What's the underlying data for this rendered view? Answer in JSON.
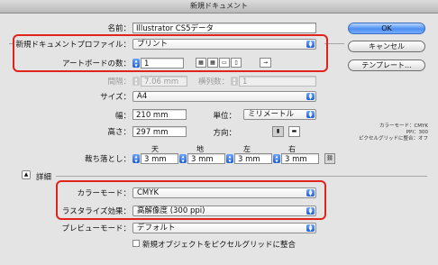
{
  "window": {
    "title": "新規ドキュメント"
  },
  "fields": {
    "name_label": "名前：",
    "name_value": "Illustrator CS5データ",
    "profile_label": "新規ドキュメントプロファイル：",
    "profile_value": "プリント",
    "artboards_label": "アートボードの数：",
    "artboards_value": "1",
    "spacing_label": "間隔：",
    "spacing_value": "7.06 mm",
    "columns_label": "横列数：",
    "columns_value": "1",
    "size_label": "サイズ：",
    "size_value": "A4",
    "width_label": "幅：",
    "width_value": "210 mm",
    "units_label": "単位：",
    "units_value": "ミリメートル",
    "height_label": "高さ：",
    "height_value": "297 mm",
    "orientation_label": "方向：",
    "bleed_label": "裁ち落とし：",
    "bleed_top_label": "天",
    "bleed_bottom_label": "地",
    "bleed_left_label": "左",
    "bleed_right_label": "右",
    "bleed_top": "3 mm",
    "bleed_bottom": "3 mm",
    "bleed_left": "3 mm",
    "bleed_right": "3 mm",
    "advanced_label": "詳細",
    "color_mode_label": "カラーモード：",
    "color_mode_value": "CMYK",
    "raster_label": "ラスタライズ効果：",
    "raster_value": "高解像度 (300 ppi)",
    "preview_label": "プレビューモード：",
    "preview_value": "デフォルト",
    "align_pixel_label": "新規オブジェクトをピクセルグリッドに整合"
  },
  "buttons": {
    "ok": "OK",
    "cancel": "キャンセル",
    "templates": "テンプレート..."
  },
  "sidenote": {
    "line1": "カラーモード：CMYK",
    "line2": "PPI：300",
    "line3": "ピクセルグリッドに整合：オフ"
  },
  "colors": {
    "highlight": "#e0231b",
    "accent": "#1d5fd6"
  }
}
